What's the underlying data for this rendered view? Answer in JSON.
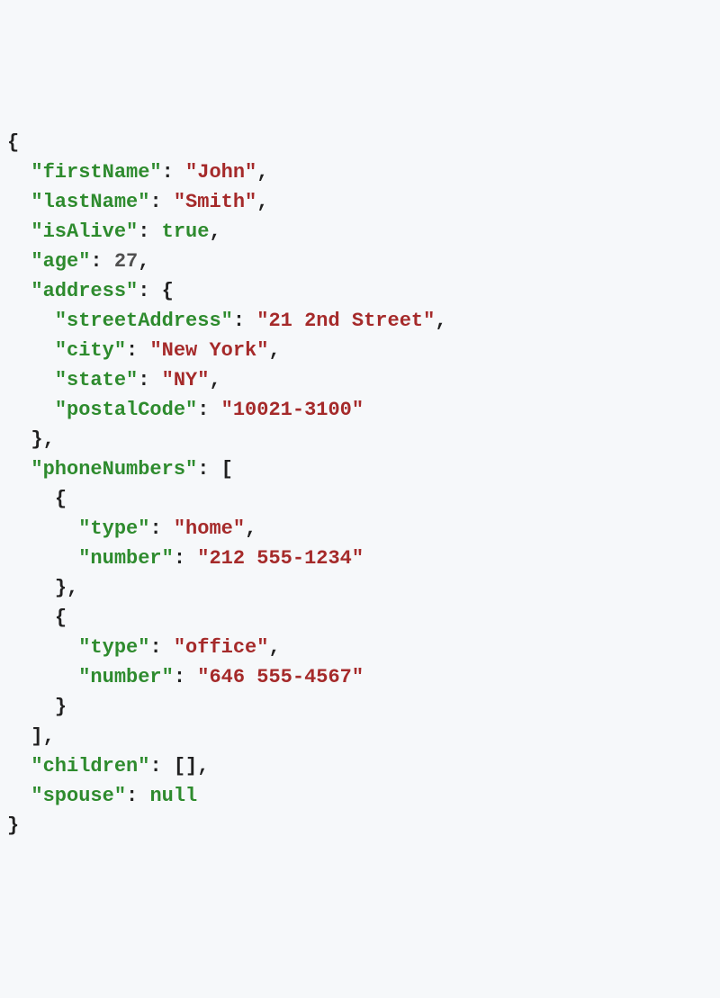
{
  "json": {
    "keys": {
      "firstName": "\"firstName\"",
      "lastName": "\"lastName\"",
      "isAlive": "\"isAlive\"",
      "age": "\"age\"",
      "address": "\"address\"",
      "streetAddress": "\"streetAddress\"",
      "city": "\"city\"",
      "state": "\"state\"",
      "postalCode": "\"postalCode\"",
      "phoneNumbers": "\"phoneNumbers\"",
      "type": "\"type\"",
      "number": "\"number\"",
      "children": "\"children\"",
      "spouse": "\"spouse\""
    },
    "values": {
      "firstName": "\"John\"",
      "lastName": "\"Smith\"",
      "isAlive": "true",
      "age": "27",
      "streetAddress": "\"21 2nd Street\"",
      "city": "\"New York\"",
      "state": "\"NY\"",
      "postalCode": "\"10021-3100\"",
      "type1": "\"home\"",
      "number1": "\"212 555-1234\"",
      "type2": "\"office\"",
      "number2": "\"646 555-4567\"",
      "children": "[]",
      "spouse": "null"
    },
    "punct": {
      "colon_sp": ": ",
      "comma": ",",
      "lbrace": "{",
      "rbrace": "}",
      "lbrack": "[",
      "rbrack": "]"
    },
    "indent": {
      "i1": "  ",
      "i2": "    ",
      "i3": "      "
    }
  }
}
